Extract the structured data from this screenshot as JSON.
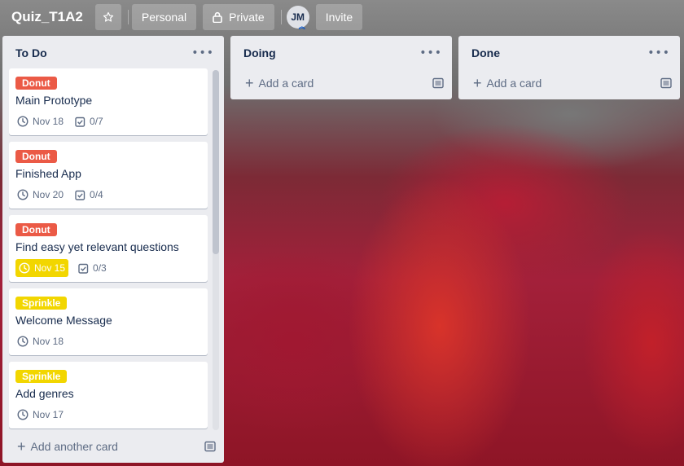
{
  "board": {
    "title": "Quiz_T1A2",
    "visibility_team": "Personal",
    "visibility_privacy": "Private",
    "member_initials": "JM",
    "invite_label": "Invite"
  },
  "lists": [
    {
      "title": "To Do",
      "add_label": "Add another card",
      "cards": [
        {
          "label": "Donut",
          "label_color": "#eb5a46",
          "title": "Main Prototype",
          "due": "Nov 18",
          "checklist": "0/7",
          "due_soon": false
        },
        {
          "label": "Donut",
          "label_color": "#eb5a46",
          "title": "Finished App",
          "due": "Nov 20",
          "checklist": "0/4",
          "due_soon": false
        },
        {
          "label": "Donut",
          "label_color": "#eb5a46",
          "title": "Find easy yet relevant questions",
          "due": "Nov 15",
          "checklist": "0/3",
          "due_soon": true
        },
        {
          "label": "Sprinkle",
          "label_color": "#f2d600",
          "title": "Welcome Message",
          "due": "Nov 18",
          "due_soon": false
        },
        {
          "label": "Sprinkle",
          "label_color": "#f2d600",
          "title": "Add genres",
          "due": "Nov 17",
          "due_soon": false
        }
      ]
    },
    {
      "title": "Doing",
      "add_label": "Add a card"
    },
    {
      "title": "Done",
      "add_label": "Add a card"
    }
  ],
  "icons": {
    "star": "star-icon",
    "lock": "lock-icon",
    "menu": "ellipsis-icon",
    "plus": "plus-icon",
    "template": "card-template-icon",
    "clock": "clock-icon",
    "checklist": "checklist-icon"
  },
  "colors": {
    "list_bg": "#ebecf0",
    "label_red": "#eb5a46",
    "label_yellow": "#f2d600",
    "text": "#172b4d",
    "muted": "#5e6c84"
  }
}
